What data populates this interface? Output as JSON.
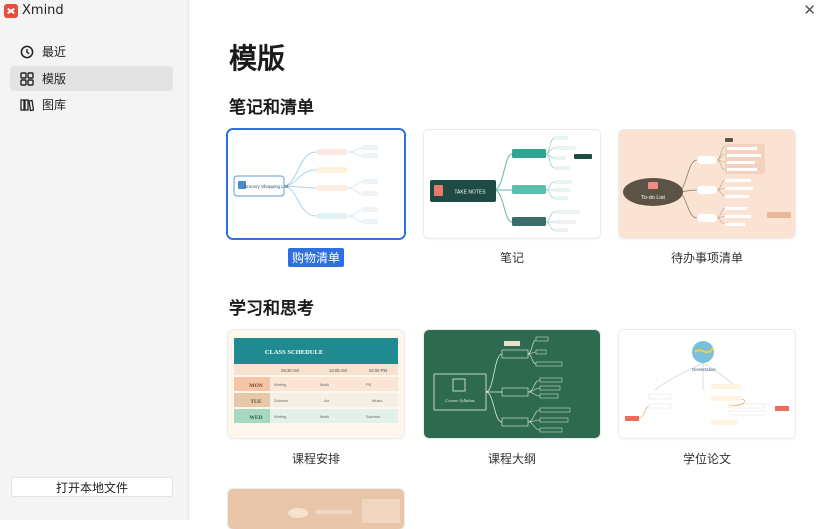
{
  "app": {
    "name": "Xmind"
  },
  "sidebar": {
    "items": [
      {
        "label": "最近",
        "icon": "clock-icon"
      },
      {
        "label": "模版",
        "icon": "grid-icon",
        "active": true
      },
      {
        "label": "图库",
        "icon": "library-icon"
      }
    ],
    "open_local_label": "打开本地文件"
  },
  "main": {
    "title": "模版",
    "sections": [
      {
        "title": "笔记和清单",
        "templates": [
          {
            "label": "购物清单",
            "selected": true,
            "card_text": "Grocery Shopping List"
          },
          {
            "label": "笔记",
            "card_text": "TAKE NOTES"
          },
          {
            "label": "待办事项清单",
            "card_text": "To-do List"
          }
        ]
      },
      {
        "title": "学习和思考",
        "templates": [
          {
            "label": "课程安排",
            "card_text": "CLASS SCHEDULE",
            "schedule": {
              "times": [
                "09:30 AM",
                "10:05 AM",
                "02:00 PM"
              ],
              "rows": [
                {
                  "day": "MON",
                  "cells": [
                    "Writing",
                    "Math",
                    "PE"
                  ]
                },
                {
                  "day": "TUE",
                  "cells": [
                    "Science",
                    "Art",
                    "Music"
                  ]
                },
                {
                  "day": "WED",
                  "cells": [
                    "Writing",
                    "Math",
                    "Science"
                  ]
                }
              ]
            }
          },
          {
            "label": "课程大纲",
            "card_text": "Course Syllabus"
          },
          {
            "label": "学位论文",
            "card_text": "Dissertation"
          }
        ]
      }
    ]
  },
  "colors": {
    "accent": "#2f6fdf",
    "sidebar_bg": "#f4f4f4",
    "brand": "#e84c3d"
  }
}
